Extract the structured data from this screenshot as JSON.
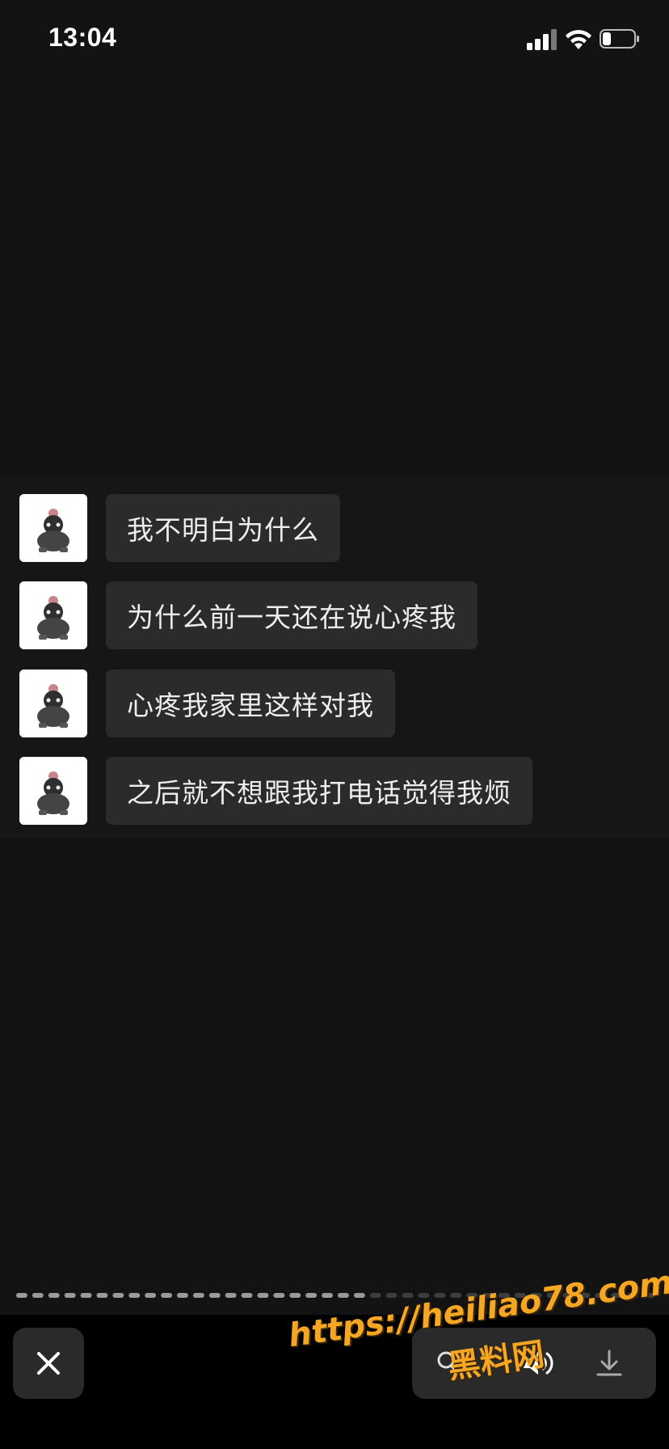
{
  "status_bar": {
    "time": "13:04"
  },
  "messages": [
    {
      "text": "我不明白为什么"
    },
    {
      "text": "为什么前一天还在说心疼我"
    },
    {
      "text": "心疼我家里这样对我"
    },
    {
      "text": "之后就不想跟我打电话觉得我烦"
    }
  ],
  "progress": {
    "segments": 40,
    "played_fraction": 0.56
  },
  "bottom_bar": {
    "icons": [
      "close-icon",
      "search-person-icon",
      "speaker-icon",
      "download-icon"
    ]
  },
  "watermark": {
    "url": "https://heiliao78.com",
    "name": "黑料网"
  },
  "colors": {
    "background": "#131313",
    "bubble": "#2b2b2b",
    "watermark": "#f5a623"
  }
}
